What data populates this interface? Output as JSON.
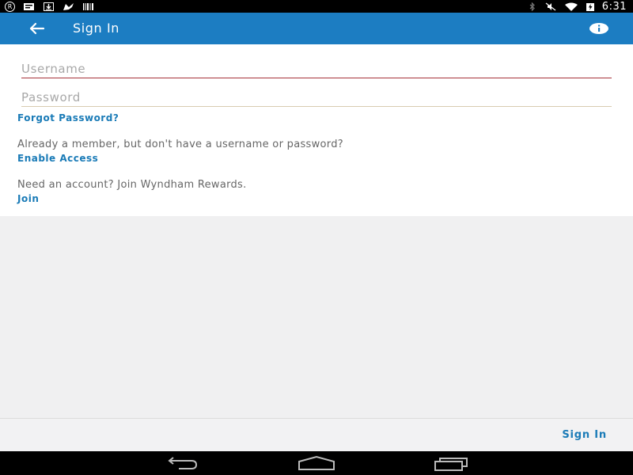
{
  "status_bar": {
    "time": "6:31",
    "left_icons": [
      "registered-icon",
      "message-icon",
      "download-icon",
      "sign-icon",
      "barcode-icon"
    ],
    "right_icons": [
      "bluetooth-icon",
      "mute-icon",
      "wifi-icon",
      "battery-icon"
    ]
  },
  "app_bar": {
    "title": "Sign In",
    "background": "#1c7dc2"
  },
  "form": {
    "username_placeholder": "Username",
    "username_value": "",
    "password_placeholder": "Password",
    "password_value": "",
    "forgot_password": "Forgot Password?",
    "member_message": "Already a member, but don't have a username or password?",
    "enable_access": "Enable Access",
    "account_message": "Need an account? Join Wyndham Rewards.",
    "join": "Join"
  },
  "bottom_bar": {
    "sign_in_label": "Sign In"
  },
  "colors": {
    "link": "#1a7bb7",
    "username_underline": "#a7333a"
  }
}
